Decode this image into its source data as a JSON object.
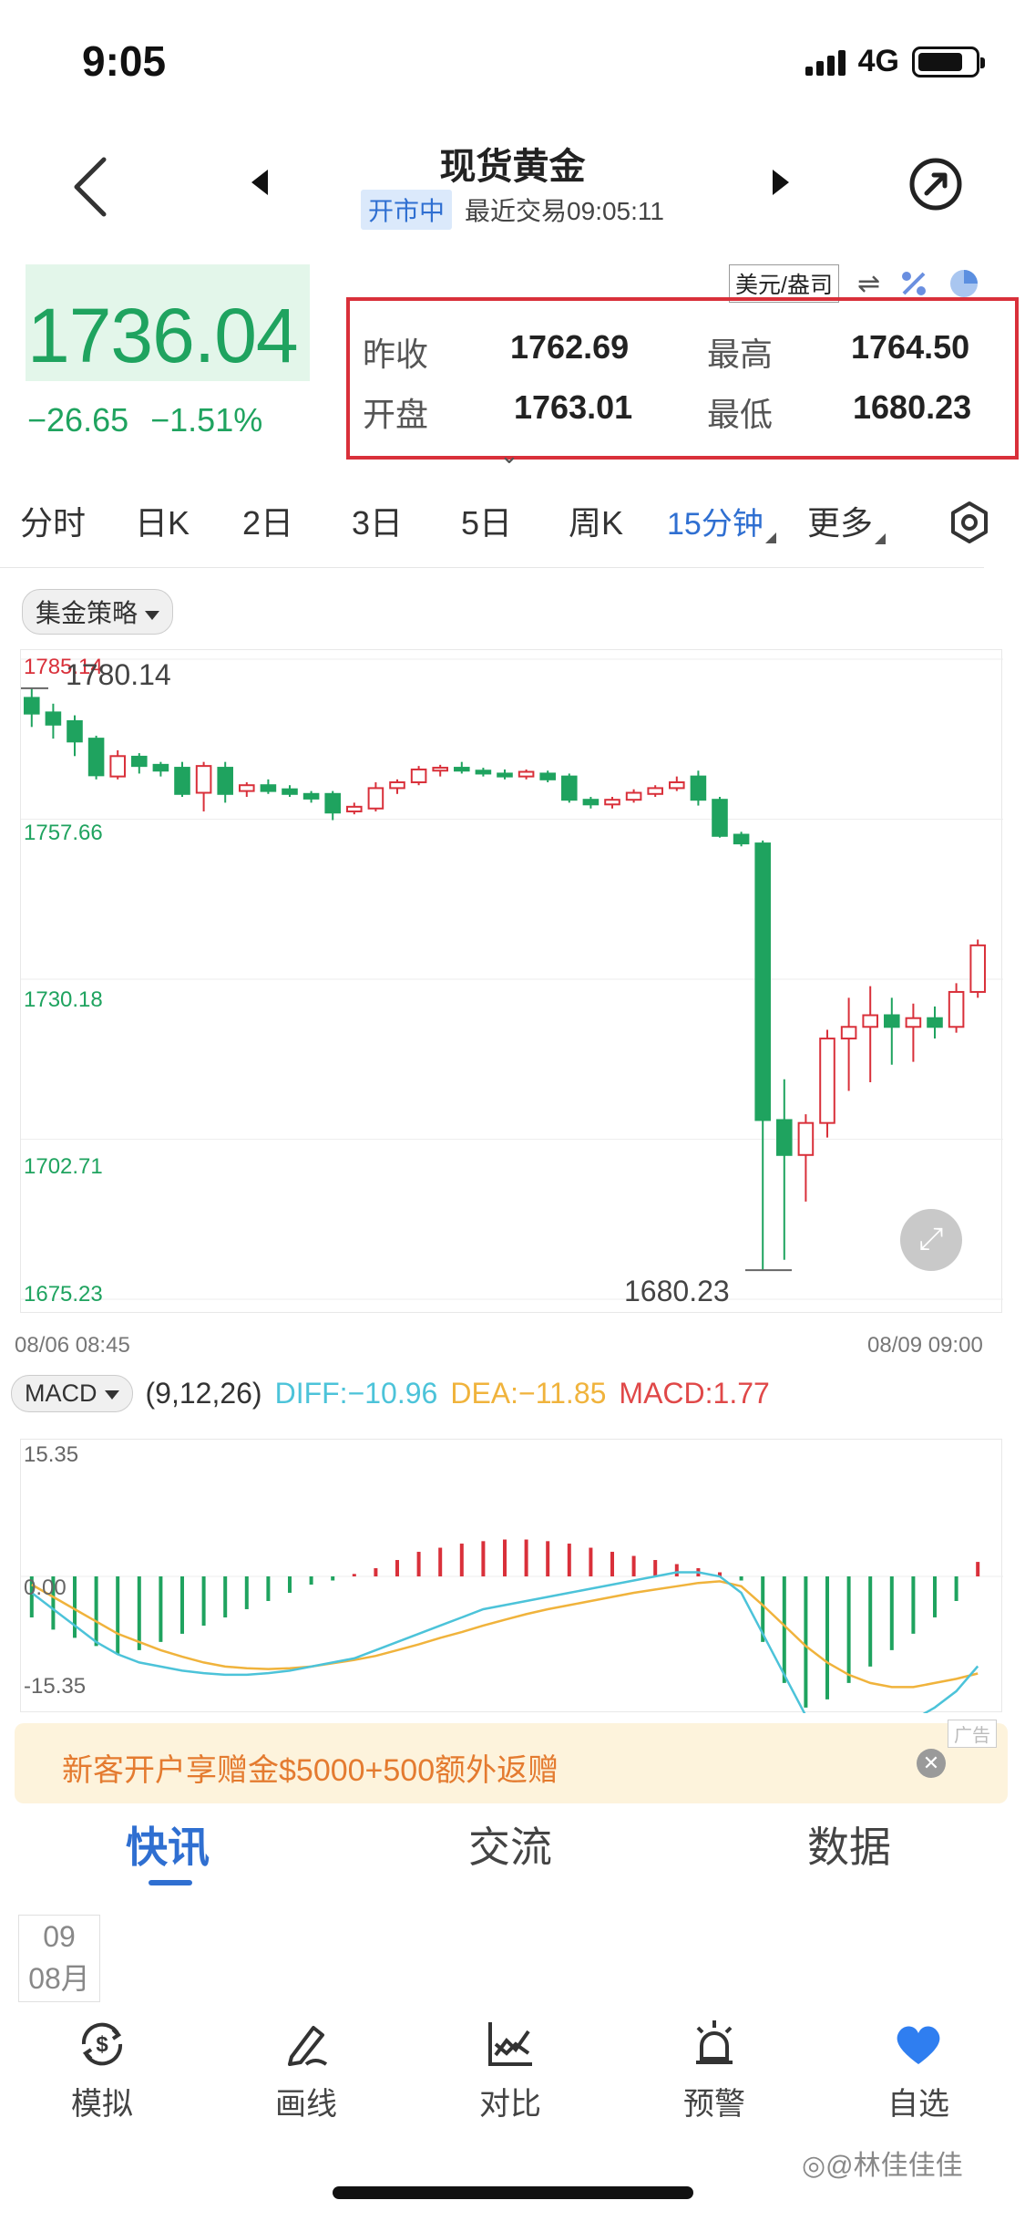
{
  "status_bar": {
    "time": "9:05",
    "network": "4G"
  },
  "header": {
    "title": "现货黄金",
    "market_status": "开市中",
    "last_trade": "最近交易09:05:11"
  },
  "quote": {
    "price": "1736.04",
    "change": "−26.65",
    "change_pct": "−1.51%",
    "unit": "美元/盎司",
    "swap_symbol": "⇌"
  },
  "ohlc": {
    "prev_close_label": "昨收",
    "prev_close": "1762.69",
    "high_label": "最高",
    "high": "1764.50",
    "open_label": "开盘",
    "open": "1763.01",
    "low_label": "最低",
    "low": "1680.23",
    "expand_symbol": "⌄"
  },
  "period_tabs": [
    {
      "label": "分时"
    },
    {
      "label": "日K"
    },
    {
      "label": "2日"
    },
    {
      "label": "3日"
    },
    {
      "label": "5日"
    },
    {
      "label": "周K"
    },
    {
      "label": "15分钟"
    },
    {
      "label": "更多"
    }
  ],
  "active_period": "15分钟",
  "strategy_pill": "集金策略",
  "chart": {
    "y_labels": [
      "1785.14",
      "1757.66",
      "1730.18",
      "1702.71",
      "1675.23"
    ],
    "x_start": "08/06 08:45",
    "x_end": "08/09 09:00",
    "high_annotation": "1780.14",
    "low_annotation": "1680.23",
    "expand_symbol": "⤢"
  },
  "chart_data": {
    "type": "candlestick",
    "ylim": [
      1675.23,
      1785.14
    ],
    "candles": [
      [
        1778.5,
        1775.8,
        1780.1,
        1773.5
      ],
      [
        1776.0,
        1773.9,
        1777.5,
        1771.5
      ],
      [
        1774.5,
        1771.0,
        1775.5,
        1768.5
      ],
      [
        1771.5,
        1765.2,
        1772.0,
        1764.5
      ],
      [
        1765.0,
        1768.5,
        1769.5,
        1764.5
      ],
      [
        1768.4,
        1766.8,
        1769.0,
        1765.5
      ],
      [
        1767.0,
        1766.0,
        1767.5,
        1765.0
      ],
      [
        1766.5,
        1762.0,
        1767.5,
        1761.5
      ],
      [
        1762.2,
        1766.8,
        1767.5,
        1759.0
      ],
      [
        1766.5,
        1762.0,
        1767.5,
        1760.5
      ],
      [
        1762.5,
        1763.5,
        1764.0,
        1761.5
      ],
      [
        1763.5,
        1762.5,
        1764.5,
        1762.0
      ],
      [
        1762.8,
        1762.0,
        1763.5,
        1761.5
      ],
      [
        1762.0,
        1761.2,
        1762.5,
        1760.5
      ],
      [
        1762.0,
        1758.8,
        1762.5,
        1757.5
      ],
      [
        1759.0,
        1759.8,
        1760.5,
        1758.5
      ],
      [
        1759.5,
        1763.0,
        1764.0,
        1759.0
      ],
      [
        1763.0,
        1764.0,
        1764.5,
        1762.0
      ],
      [
        1764.0,
        1766.2,
        1766.8,
        1763.5
      ],
      [
        1766.0,
        1766.5,
        1767.0,
        1765.0
      ],
      [
        1766.5,
        1766.0,
        1767.5,
        1765.5
      ],
      [
        1766.0,
        1765.5,
        1766.5,
        1765.0
      ],
      [
        1765.5,
        1765.0,
        1766.2,
        1764.5
      ],
      [
        1765.0,
        1765.8,
        1766.2,
        1764.5
      ],
      [
        1765.5,
        1764.5,
        1766.0,
        1764.0
      ],
      [
        1765.0,
        1761.0,
        1765.5,
        1760.5
      ],
      [
        1761.0,
        1760.2,
        1761.5,
        1759.5
      ],
      [
        1760.2,
        1761.0,
        1761.5,
        1759.5
      ],
      [
        1761.0,
        1762.2,
        1762.8,
        1760.5
      ],
      [
        1762.0,
        1763.0,
        1763.5,
        1761.5
      ],
      [
        1763.0,
        1764.0,
        1765.0,
        1762.5
      ],
      [
        1765.0,
        1761.0,
        1766.0,
        1760.0
      ],
      [
        1761.0,
        1754.8,
        1761.5,
        1754.5
      ],
      [
        1755.0,
        1753.5,
        1755.5,
        1753.0
      ],
      [
        1753.5,
        1706.0,
        1754.0,
        1680.2
      ],
      [
        1706.0,
        1700.0,
        1713.0,
        1682.0
      ],
      [
        1700.0,
        1705.5,
        1707.0,
        1692.0
      ],
      [
        1705.5,
        1720.0,
        1721.5,
        1703.0
      ],
      [
        1720.0,
        1722.0,
        1727.0,
        1711.0
      ],
      [
        1722.0,
        1724.0,
        1729.0,
        1712.5
      ],
      [
        1724.0,
        1722.0,
        1727.0,
        1715.5
      ],
      [
        1722.0,
        1723.5,
        1726.0,
        1716.0
      ],
      [
        1723.5,
        1722.0,
        1725.5,
        1720.0
      ],
      [
        1722.0,
        1728.0,
        1729.5,
        1721.0
      ],
      [
        1728.0,
        1736.0,
        1737.0,
        1727.0
      ]
    ],
    "x_range": [
      "08/06 08:45",
      "08/09 09:00"
    ]
  },
  "macd": {
    "indicator": "MACD",
    "params": "(9,12,26)",
    "diff": "DIFF:−10.96",
    "dea": "DEA:−11.85",
    "macd": "MACD:1.77",
    "y_top": "15.35",
    "y_mid": "0.00",
    "y_bottom": "-15.35",
    "ylim": [
      -15.35,
      15.35
    ],
    "histogram": [
      -5,
      -6.5,
      -7.5,
      -8.5,
      -9.5,
      -9,
      -8,
      -7,
      -6,
      -5,
      -4,
      -3,
      -2,
      -1,
      -0.5,
      0.3,
      1,
      2,
      3,
      3.5,
      4,
      4.3,
      4.5,
      4.5,
      4.3,
      4,
      3.5,
      3,
      2.5,
      2,
      1.5,
      1,
      0.5,
      -0.5,
      -8,
      -13,
      -16,
      -15,
      -13,
      -11,
      -9,
      -7,
      -5,
      -3,
      1.77
    ],
    "diff_line": [
      -2,
      -4,
      -6,
      -8,
      -9.5,
      -10.5,
      -11,
      -11.5,
      -11.8,
      -12,
      -12,
      -11.8,
      -11.5,
      -11,
      -10.5,
      -10,
      -9,
      -8,
      -7,
      -6,
      -5,
      -4,
      -3.5,
      -3,
      -2.5,
      -2,
      -1.5,
      -1,
      -0.5,
      0,
      0.5,
      0.5,
      0,
      -2,
      -7,
      -12,
      -17,
      -18.5,
      -19,
      -19,
      -18.5,
      -17.5,
      -16,
      -14,
      -10.96
    ],
    "dea_line": [
      -1,
      -2.5,
      -4,
      -5.5,
      -7,
      -8,
      -9,
      -9.8,
      -10.5,
      -11,
      -11.2,
      -11.3,
      -11.2,
      -11,
      -10.6,
      -10.2,
      -9.7,
      -9,
      -8.3,
      -7.5,
      -6.8,
      -6,
      -5.3,
      -4.6,
      -4,
      -3.5,
      -3,
      -2.5,
      -2,
      -1.6,
      -1.2,
      -0.8,
      -0.6,
      -1.2,
      -3.5,
      -6,
      -8.5,
      -10.5,
      -12,
      -13,
      -13.5,
      -13.5,
      -13,
      -12.5,
      -11.85
    ]
  },
  "banner": {
    "text": "新客开户享赠金$5000+500额外返赠",
    "ad_tag": "广告",
    "close": "✕"
  },
  "content_tabs": [
    {
      "label": "快讯"
    },
    {
      "label": "交流"
    },
    {
      "label": "数据"
    }
  ],
  "date_box": {
    "day": "09",
    "month": "08月"
  },
  "bottom_nav": [
    {
      "label": "模拟"
    },
    {
      "label": "画线"
    },
    {
      "label": "对比"
    },
    {
      "label": "预警"
    },
    {
      "label": "自选"
    }
  ],
  "watermark": "◎@林佳佳佳",
  "colors": {
    "up": "#d9303a",
    "down": "#1fa35f",
    "accent": "#2f6fd1",
    "diff": "#4cc3d9",
    "dea": "#f0b33c"
  }
}
